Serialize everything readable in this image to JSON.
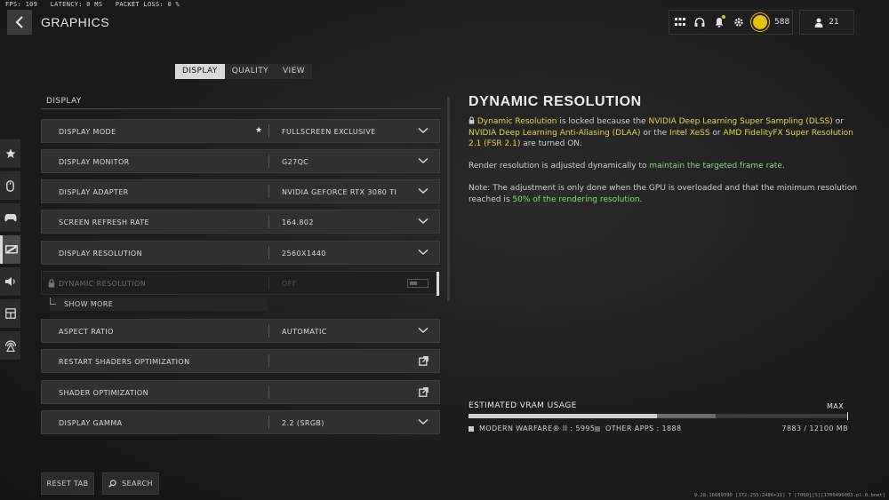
{
  "stats": {
    "fps": "FPS: 109",
    "latency": "LATENCY: 0 MS",
    "packet_loss": "PACKET LOSS: 0 %"
  },
  "header": {
    "title": "GRAPHICS",
    "cp_amount": "588",
    "party_count": "21"
  },
  "tabs": [
    "DISPLAY",
    "QUALITY",
    "VIEW"
  ],
  "active_tab": "DISPLAY",
  "section_label": "DISPLAY",
  "settings": [
    {
      "label": "DISPLAY MODE",
      "value": "FULLSCREEN EXCLUSIVE",
      "control": "dropdown",
      "starred": true
    },
    {
      "label": "DISPLAY MONITOR",
      "value": "G27QC",
      "control": "dropdown"
    },
    {
      "label": "DISPLAY ADAPTER",
      "value": "NVIDIA GEFORCE RTX 3080 TI",
      "control": "dropdown"
    },
    {
      "label": "SCREEN REFRESH RATE",
      "value": "164.802",
      "control": "dropdown"
    },
    {
      "label": "DISPLAY RESOLUTION",
      "value": "2560X1440",
      "control": "dropdown"
    },
    {
      "label": "DYNAMIC RESOLUTION",
      "value": "OFF",
      "control": "toggle",
      "locked": true
    },
    {
      "label": "ASPECT RATIO",
      "value": "AUTOMATIC",
      "control": "dropdown"
    },
    {
      "label": "RESTART SHADERS OPTIMIZATION",
      "value": "",
      "control": "external"
    },
    {
      "label": "SHADER OPTIMIZATION",
      "value": "",
      "control": "external"
    },
    {
      "label": "DISPLAY GAMMA",
      "value": "2.2 (SRGB)",
      "control": "dropdown"
    }
  ],
  "show_more": "SHOW MORE",
  "bottom": {
    "reset": "RESET TAB",
    "search": "SEARCH"
  },
  "panel": {
    "title": "DYNAMIC RESOLUTION",
    "p1": {
      "a": "Dynamic Resolution",
      "b": " is locked because the ",
      "c": "NVIDIA Deep Learning Super Sampling (DLSS)",
      "d": " or ",
      "e": "NVIDIA Deep Learning Anti-Aliasing (DLAA)",
      "f": " or the ",
      "g": "Intel XeSS",
      "h": " or ",
      "i": "AMD FidelityFX Super Resolution 2.1 (FSR 2.1)",
      "j": " are turned ON."
    },
    "p2": {
      "a": "Render resolution is adjusted dynamically to ",
      "b": "maintain the targeted frame rate",
      "c": "."
    },
    "p3": {
      "a": "Note: The adjustment is only done when the GPU is overloaded and that the minimum resolution reached is ",
      "b": "50% of the rendering resolution",
      "c": "."
    }
  },
  "vram": {
    "label": "ESTIMATED VRAM USAGE",
    "max_label": "MAX",
    "game_label": "MODERN WARFARE® II : 5995",
    "other_label": "OTHER APPS : 1888",
    "total_label": "7883 / 12100 MB",
    "game_mb": 5995,
    "other_mb": 1888,
    "max_mb": 12100
  },
  "footer": "9.28.16689390 [172:255:2486+11] T [7000][S][1700496003.pl.0.bnet]",
  "colors": {
    "highlight_yellow": "#e3d44a",
    "highlight_green": "#8fd18a",
    "cp_gold": "#e3c400"
  }
}
